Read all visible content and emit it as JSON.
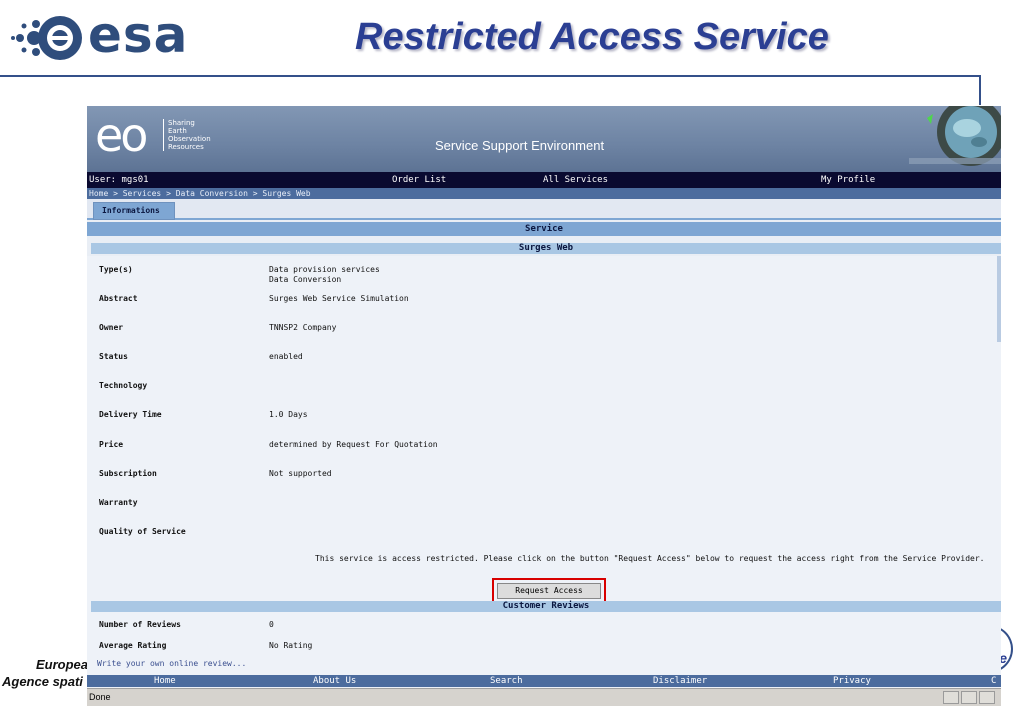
{
  "slide": {
    "logo_text": "esa",
    "title": "Restricted Access Service",
    "footer_line1": "European",
    "footer_line2": "Agence spati",
    "side_letter": "e",
    "colors": {
      "title": "#2b3f93",
      "rule": "#34508a",
      "logo": "#2f4d7c"
    }
  },
  "browser": {
    "header": {
      "logo_letters": "eo",
      "logo_tagline": [
        "Sharing",
        "Earth",
        "Observation",
        "Resources"
      ],
      "app_title": "Service Support Environment"
    },
    "nav": {
      "user": "User: mgs01",
      "order_list": "Order List",
      "all_services": "All Services",
      "my_profile": "My Profile"
    },
    "breadcrumb": "Home > Services > Data Conversion > Surges Web",
    "tab": "Informations",
    "section_title": "Service",
    "service_name": "Surges Web",
    "properties": [
      {
        "label": "Type(s)",
        "value": "Data provision services",
        "value2": "Data Conversion"
      },
      {
        "label": "Abstract",
        "value": "Surges Web Service Simulation",
        "value2": ""
      },
      {
        "label": "Owner",
        "value": "TNNSP2 Company",
        "value2": ""
      },
      {
        "label": "Status",
        "value": "enabled",
        "value2": ""
      },
      {
        "label": "Technology",
        "value": "",
        "value2": ""
      },
      {
        "label": "Delivery Time",
        "value": "1.0 Days",
        "value2": ""
      },
      {
        "label": "Price",
        "value": "determined by Request For Quotation",
        "value2": ""
      },
      {
        "label": "Subscription",
        "value": "Not supported",
        "value2": ""
      },
      {
        "label": "Warranty",
        "value": "",
        "value2": ""
      },
      {
        "label": "Quality of Service",
        "value": "",
        "value2": ""
      }
    ],
    "notice": "This service is access restricted. Please click on the button \"Request Access\" below to request the access right from the Service Provider.",
    "request_button": "Request Access",
    "reviews_title": "Customer Reviews",
    "reviews": [
      {
        "label": "Number of Reviews",
        "value": "0"
      },
      {
        "label": "Average Rating",
        "value": "No Rating"
      }
    ],
    "write_review": "Write your own online review...",
    "footer": {
      "home": "Home",
      "about": "About Us",
      "search": "Search",
      "disclaimer": "Disclaimer",
      "privacy": "Privacy",
      "cut": "C"
    },
    "status": "Done"
  }
}
